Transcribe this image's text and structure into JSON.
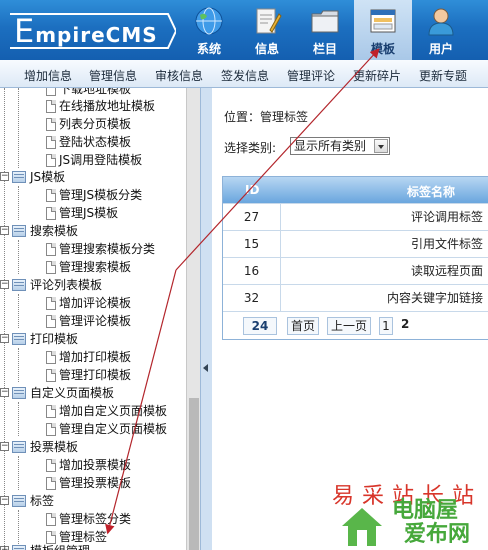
{
  "header": {
    "logo_first": "E",
    "logo_rest": "mpireCMS",
    "nav": [
      {
        "label": "系统",
        "icon": "globe-icon",
        "active": false
      },
      {
        "label": "信息",
        "icon": "document-pen-icon",
        "active": false
      },
      {
        "label": "栏目",
        "icon": "folder-icon",
        "active": false
      },
      {
        "label": "模板",
        "icon": "template-window-icon",
        "active": true
      },
      {
        "label": "用户",
        "icon": "user-icon",
        "active": false
      }
    ]
  },
  "submenu": [
    "增加信息",
    "管理信息",
    "审核信息",
    "签发信息",
    "管理评论",
    "更新碎片",
    "更新专题"
  ],
  "tree": [
    {
      "text": "下载地址模板",
      "type": "doc"
    },
    {
      "text": "在线播放地址模板",
      "type": "doc"
    },
    {
      "text": "列表分页模板",
      "type": "doc"
    },
    {
      "text": "登陆状态模板",
      "type": "doc"
    },
    {
      "text": "JS调用登陆模板",
      "type": "doc"
    },
    {
      "text": "JS模板",
      "type": "folder"
    },
    {
      "text": "管理JS模板分类",
      "type": "doc"
    },
    {
      "text": "管理JS模板",
      "type": "doc"
    },
    {
      "text": "搜索模板",
      "type": "folder"
    },
    {
      "text": "管理搜索模板分类",
      "type": "doc"
    },
    {
      "text": "管理搜索模板",
      "type": "doc"
    },
    {
      "text": "评论列表模板",
      "type": "folder"
    },
    {
      "text": "增加评论模板",
      "type": "doc"
    },
    {
      "text": "管理评论模板",
      "type": "doc"
    },
    {
      "text": "打印模板",
      "type": "folder"
    },
    {
      "text": "增加打印模板",
      "type": "doc"
    },
    {
      "text": "管理打印模板",
      "type": "doc"
    },
    {
      "text": "自定义页面模板",
      "type": "folder"
    },
    {
      "text": "增加自定义页面模板",
      "type": "doc"
    },
    {
      "text": "管理自定义页面模板",
      "type": "doc"
    },
    {
      "text": "投票模板",
      "type": "folder"
    },
    {
      "text": "增加投票模板",
      "type": "doc"
    },
    {
      "text": "管理投票模板",
      "type": "doc"
    },
    {
      "text": "标签",
      "type": "folder"
    },
    {
      "text": "管理标签分类",
      "type": "doc"
    },
    {
      "text": "管理标签",
      "type": "doc"
    },
    {
      "text": "模板组管理",
      "type": "folder"
    }
  ],
  "main": {
    "breadcrumb": "位置：管理标签",
    "filter_label": "选择类别:",
    "filter_value": "显示所有类别",
    "table": {
      "headers": [
        "ID",
        "标签名称"
      ],
      "rows": [
        {
          "id": "27",
          "name": "评论调用标签"
        },
        {
          "id": "15",
          "name": "引用文件标签"
        },
        {
          "id": "16",
          "name": "读取远程页面"
        },
        {
          "id": "32",
          "name": "内容关键字加链接"
        }
      ],
      "pager": {
        "total": "24",
        "first": "首页",
        "prev": "上一页",
        "current": "1",
        "next_page": "2"
      }
    }
  },
  "watermark": {
    "line1": "易采站长站",
    "line2_a": "电脑屋",
    "line2_b": "爱布网"
  }
}
